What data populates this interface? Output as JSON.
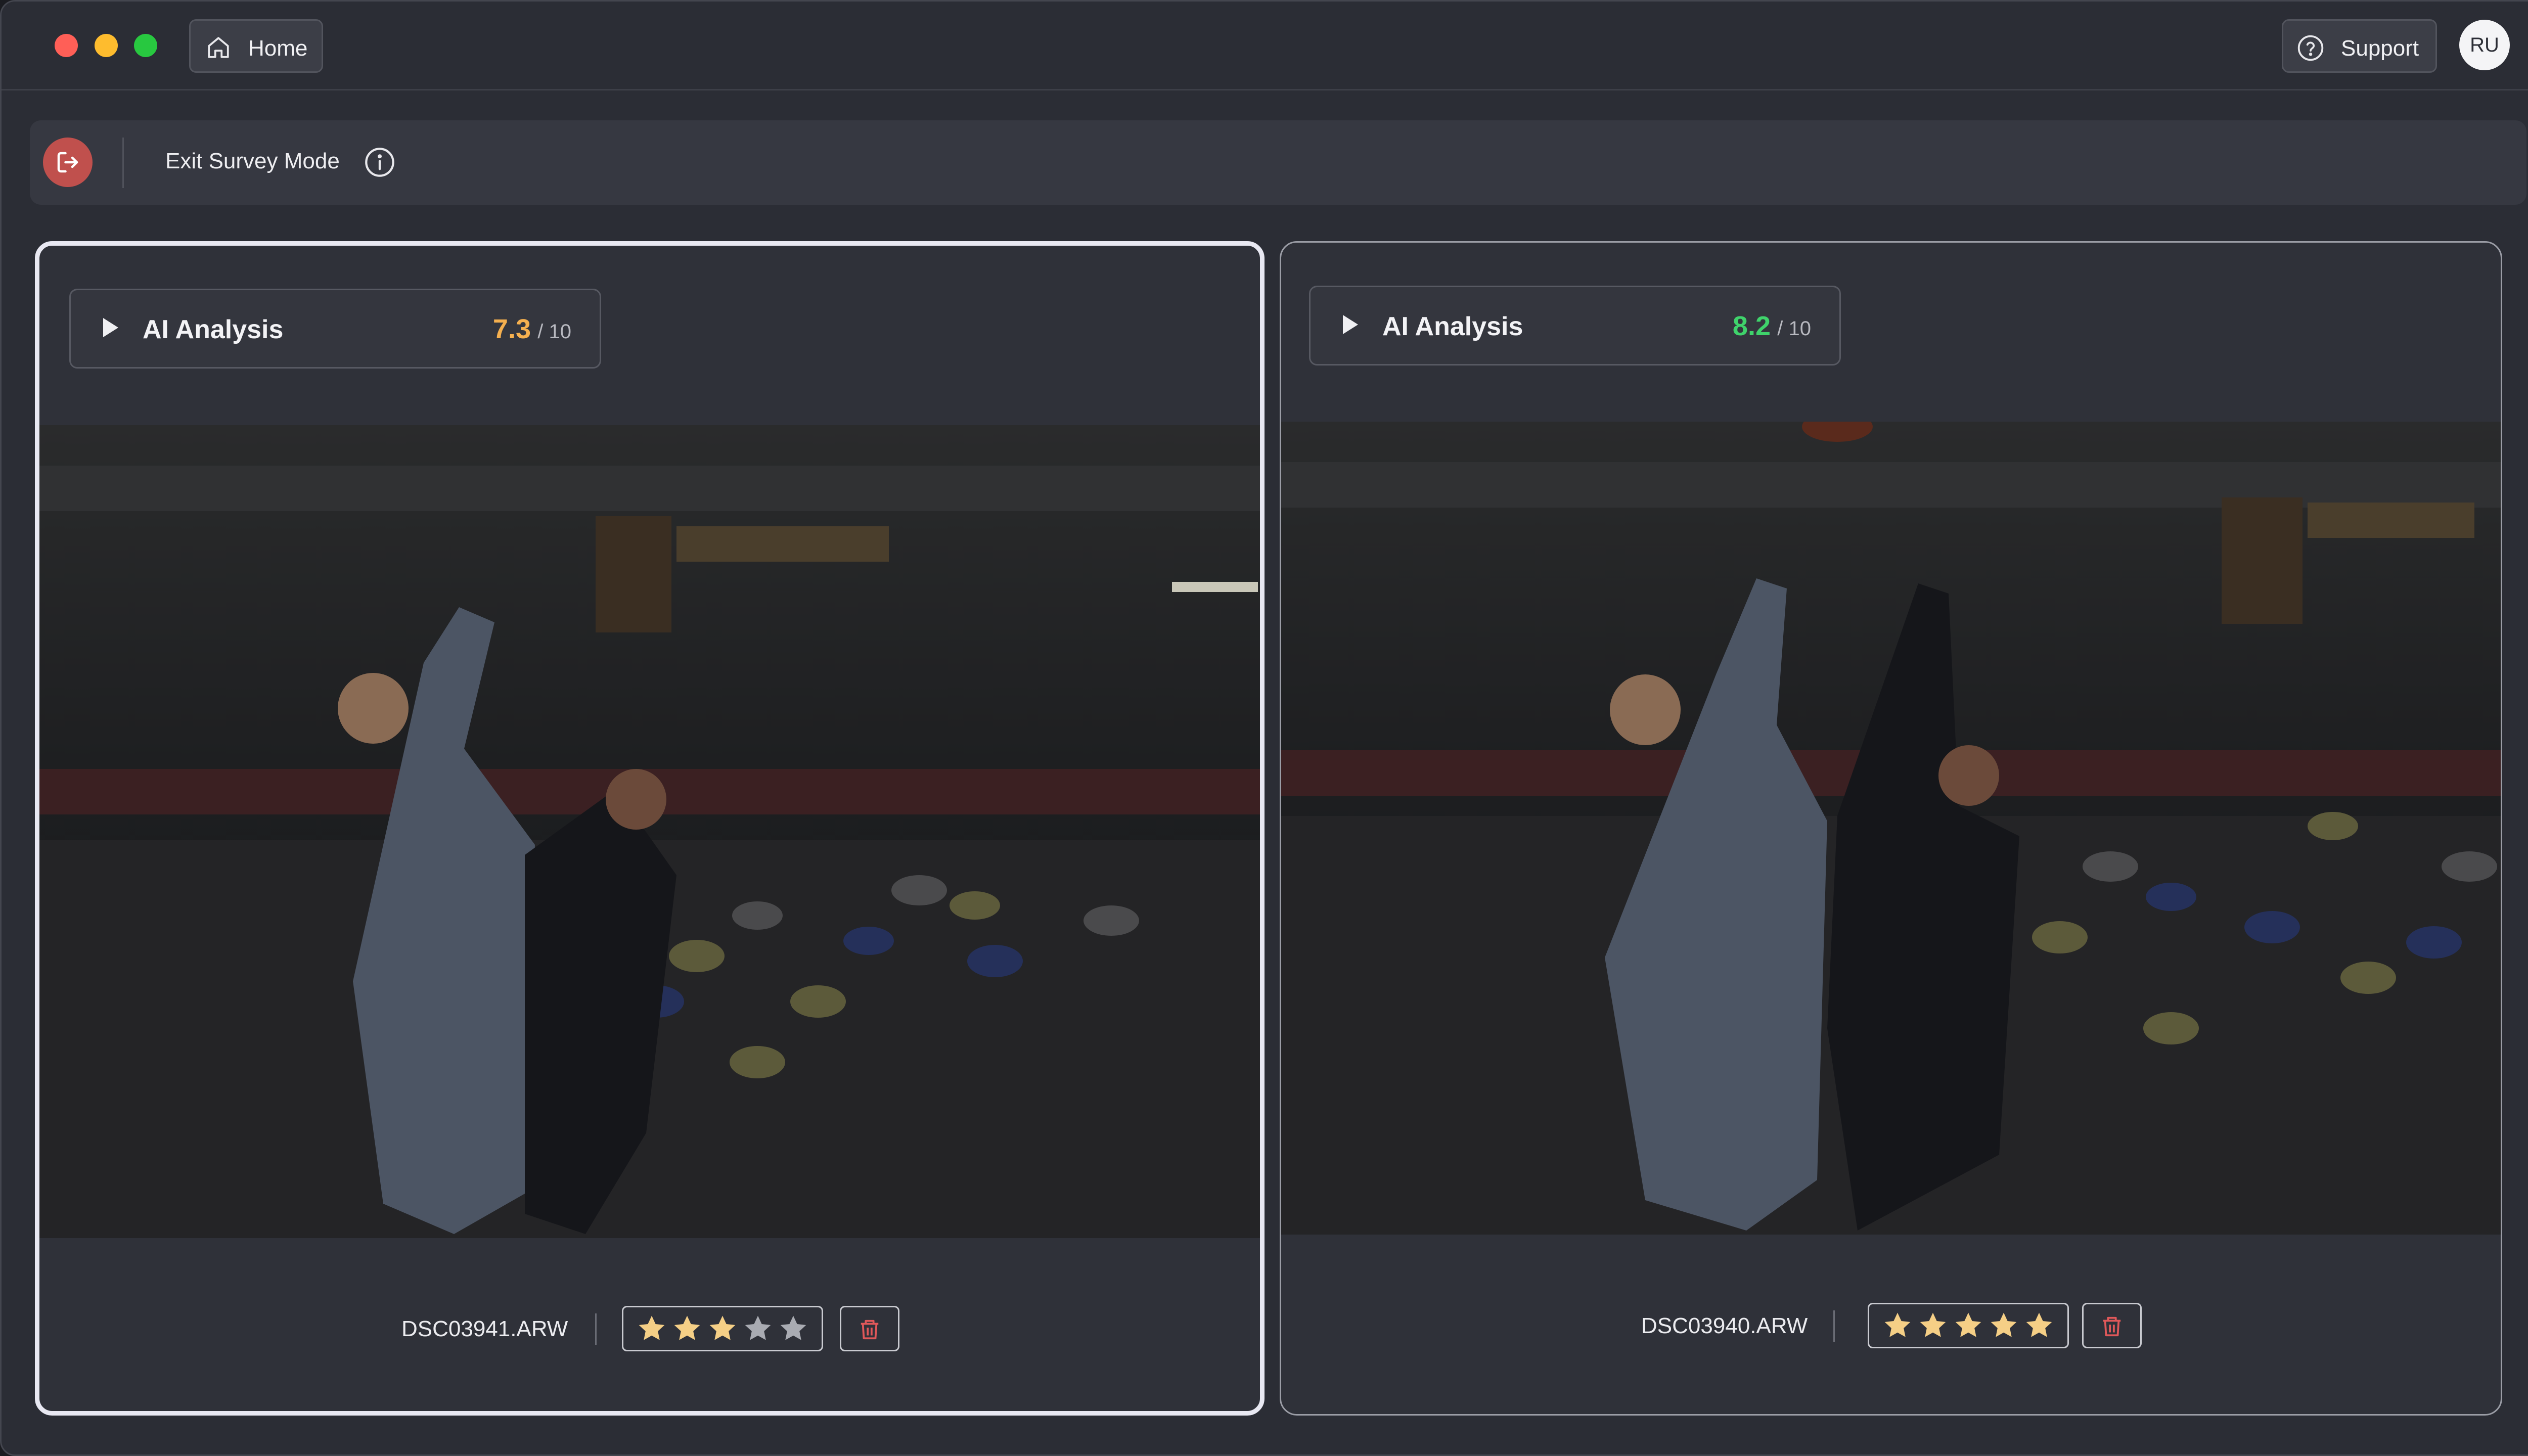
{
  "titlebar": {
    "home_label": "Home",
    "support_label": "Support",
    "avatar_initials": "RU"
  },
  "survey_bar": {
    "exit_label": "Exit Survey Mode"
  },
  "panels": [
    {
      "selected": true,
      "ai_label": "AI Analysis",
      "score": "7.3",
      "score_of": "/ 10",
      "score_color": "#f5b04f",
      "filename": "DSC03941.ARW",
      "rating": 3,
      "max_rating": 5
    },
    {
      "selected": false,
      "ai_label": "AI Analysis",
      "score": "8.2",
      "score_of": "/ 10",
      "score_color": "#3fd36b",
      "filename": "DSC03940.ARW",
      "rating": 5,
      "max_rating": 5
    }
  ],
  "colors": {
    "star_filled": "#f5cf86",
    "star_empty": "#a9abb2",
    "trash": "#e0585a"
  }
}
